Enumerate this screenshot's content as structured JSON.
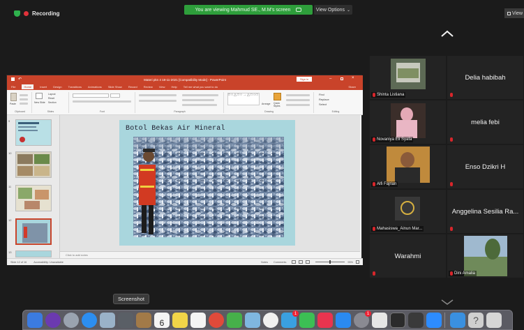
{
  "topbar": {
    "recording_label": "Recording",
    "banner_text": "You are viewing Mahmud SE., M.M's screen",
    "view_options_label": "View Options",
    "view_label": "View"
  },
  "powerpoint": {
    "window_title": "Materi pkn 4 18-11-2021 [Compatibility Mode] - PowerPoint",
    "signin_label": "Sign in",
    "tabs": [
      "File",
      "Home",
      "Insert",
      "Design",
      "Transitions",
      "Animations",
      "Slide Show",
      "Record",
      "Review",
      "View",
      "Help",
      "Tell me what you want to do"
    ],
    "share_label": "Share",
    "ribbon_groups": [
      "Clipboard",
      "Slides",
      "Font",
      "Paragraph",
      "Drawing",
      "Editing"
    ],
    "ribbon_buttons": {
      "paste": "Paste",
      "new_slide": "New Slide",
      "layout": "Layout",
      "reset": "Reset",
      "section": "Section",
      "arrange": "Arrange",
      "quick_styles": "Quick Styles",
      "find": "Find",
      "replace": "Replace",
      "select": "Select"
    },
    "slide_numbers": [
      "9",
      "10",
      "11",
      "12",
      "13"
    ],
    "slide_title": "Botol Bekas Air Mineral",
    "notes_placeholder": "Click to add notes",
    "status": {
      "slide_info": "Slide 12 of 16",
      "accessibility": "Accessibility: Unavailable",
      "notes": "Notes",
      "comments": "Comments",
      "zoom": "95%"
    }
  },
  "participants": [
    {
      "name": "Shinta Listiana",
      "type": "video"
    },
    {
      "name": "Delia habibah",
      "type": "name"
    },
    {
      "name": "Novaniya Eli Syafa",
      "type": "video"
    },
    {
      "name": "melia febi",
      "type": "name"
    },
    {
      "name": "Alfi Fajrian",
      "type": "video"
    },
    {
      "name": "Enso Dzikri H",
      "type": "name"
    },
    {
      "name": "Mahasiswa_Ainun Mar...",
      "type": "video"
    },
    {
      "name": "Anggelina Sesilia Ra...",
      "type": "name"
    },
    {
      "name": "Warahmi",
      "type": "name"
    },
    {
      "name": "Dini Amalia",
      "type": "video"
    }
  ],
  "dock": {
    "tooltip": "Screenshot",
    "calendar_day": "6",
    "badge_mail": "1",
    "badge_settings": "1"
  },
  "colors": {
    "ppt_red": "#c9432a",
    "banner_green": "#2e9e3b",
    "mic_muted": "#d8262b"
  }
}
